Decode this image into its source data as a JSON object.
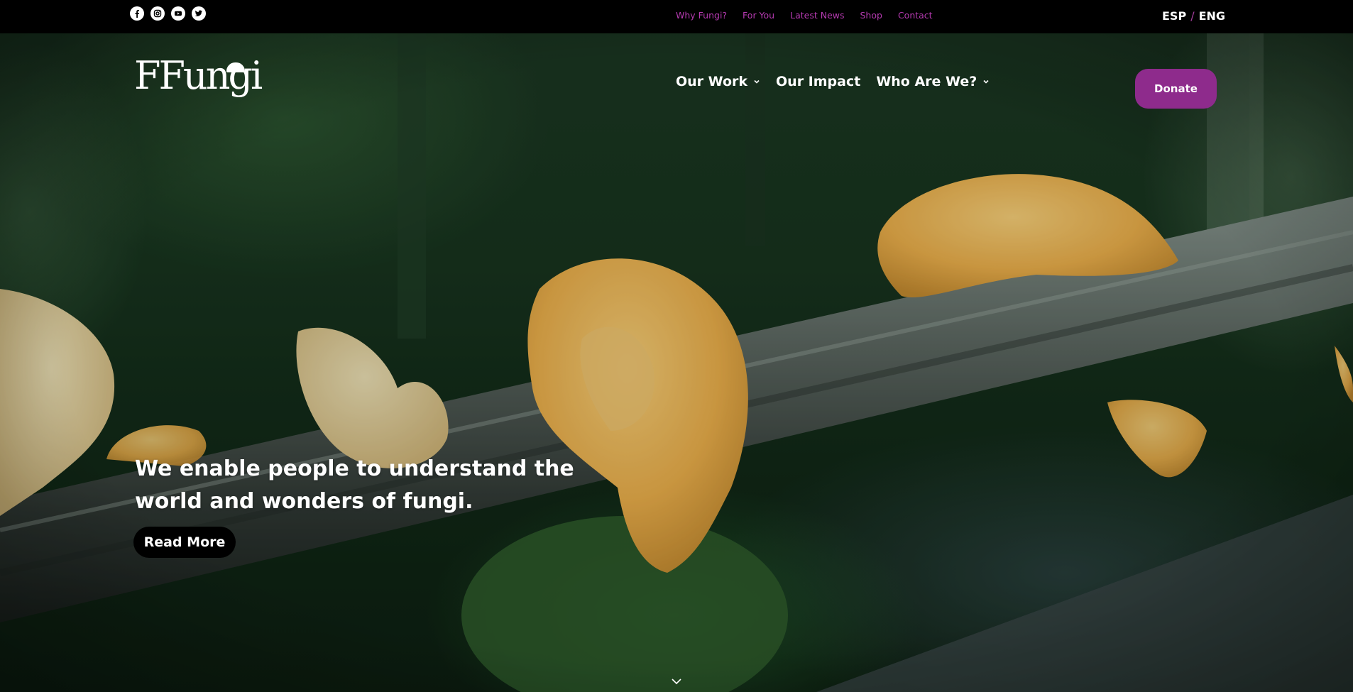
{
  "social": {
    "icons": [
      "facebook-icon",
      "instagram-icon",
      "youtube-icon",
      "twitter-icon"
    ]
  },
  "top_nav": {
    "items": [
      "Why Fungi?",
      "For You",
      "Latest News",
      "Shop",
      "Contact"
    ]
  },
  "language": {
    "options": [
      "ESP",
      "ENG"
    ],
    "separator": "/"
  },
  "logo": {
    "text": "FFungi"
  },
  "main_nav": {
    "our_work": "Our Work",
    "our_impact": "Our Impact",
    "who_are_we": "Who Are We?"
  },
  "donate_label": "Donate",
  "hero": {
    "headline": "We enable people to understand the world and wonders of fungi.",
    "cta_label": "Read More"
  },
  "colors": {
    "brand_purple": "#8e2b8c",
    "top_nav_link": "#b53ab0",
    "top_bar_bg": "#000000",
    "fungi_orange": "#f0b048"
  }
}
